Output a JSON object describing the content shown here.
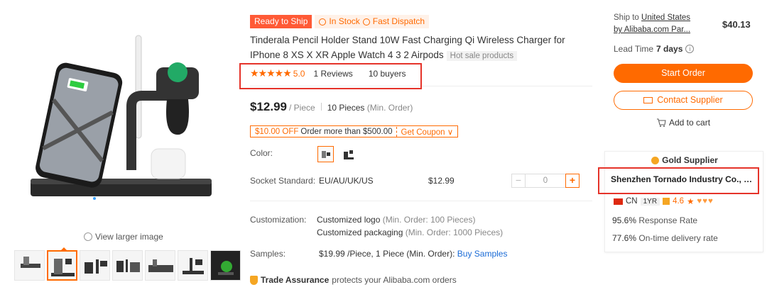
{
  "gallery": {
    "view_larger": "View larger image",
    "thumbnails": [
      "thumb-1",
      "thumb-2",
      "thumb-3",
      "thumb-4",
      "thumb-5",
      "thumb-6",
      "thumb-7"
    ],
    "active_thumb": 1
  },
  "product": {
    "badge_ready": "Ready to Ship",
    "badge_stock": "In Stock",
    "badge_dispatch": "Fast Dispatch",
    "title": "Tinderala Pencil Holder Stand 10W Fast Charging Qi Wireless Charger for IPhone 8 XS X XR Apple Watch 4 3 2 Airpods",
    "hot_tag": "Hot sale products",
    "stars": "★★★★★",
    "score": "5.0",
    "reviews": "1 Reviews",
    "buyers": "10 buyers",
    "price": "$12.99",
    "price_unit": "/ Piece",
    "moq": "10 Pieces",
    "moq_note": "(Min. Order)",
    "coupon_off": "$10.00 OFF",
    "coupon_desc": "Order more than $500.00",
    "coupon_get": "Get Coupon ∨",
    "color_label": "Color:",
    "socket_label": "Socket Standard:",
    "socket_value": "EU/AU/UK/US",
    "socket_price": "$12.99",
    "qty_value": "0",
    "customization_label": "Customization:",
    "cust_logo": "Customized logo",
    "cust_logo_note": "(Min. Order: 100 Pieces)",
    "cust_pack": "Customized packaging",
    "cust_pack_note": "(Min. Order: 1000 Pieces)",
    "samples_label": "Samples:",
    "samples_value": "$19.99 /Piece, 1 Piece (Min. Order):",
    "samples_link": "Buy Samples",
    "trade_title": "Trade Assurance",
    "trade_desc": "protects your Alibaba.com orders"
  },
  "order": {
    "ship_to": "Ship to",
    "ship_country": "United States",
    "ship_by": "by Alibaba.com Par...",
    "ship_price": "$40.13",
    "lead_label": "Lead Time",
    "lead_days": "7 days",
    "start_order": "Start Order",
    "contact_supplier": "Contact Supplier",
    "add_to_cart": "Add to cart"
  },
  "supplier": {
    "gold": "Gold Supplier",
    "name": "Shenzhen Tornado Industry Co., L...",
    "country": "CN",
    "years": "1YR",
    "rating": "4.6",
    "rating_star": "★",
    "hearts": "♥♥♥",
    "response_rate": "95.6%",
    "response_label": "Response Rate",
    "ontime_rate": "77.6%",
    "ontime_label": "On-time delivery rate"
  },
  "colors": {
    "accent": "#ff6a00",
    "highlight": "#e5332a",
    "link": "#1a6bd6"
  }
}
